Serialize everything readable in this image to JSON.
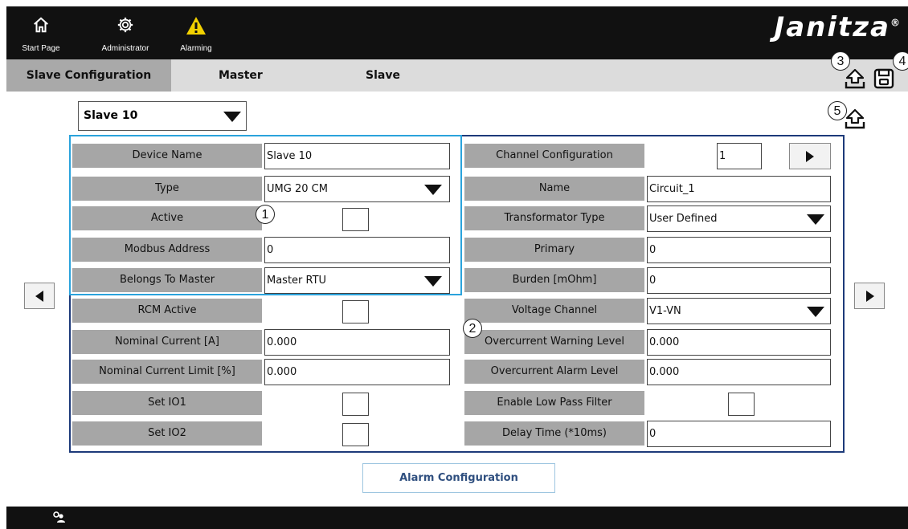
{
  "nav": {
    "start_page": "Start Page",
    "administrator": "Administrator",
    "alarming": "Alarming",
    "logo": "Janitza",
    "logo_mark": "®"
  },
  "tabs": {
    "slave_configuration": "Slave Configuration",
    "master": "Master",
    "slave": "Slave"
  },
  "device_select": {
    "value": "Slave 10"
  },
  "left_panel": {
    "device_name": {
      "label": "Device Name",
      "value": "Slave 10"
    },
    "type": {
      "label": "Type",
      "value": "UMG 20 CM"
    },
    "active": {
      "label": "Active"
    },
    "modbus_address": {
      "label": "Modbus Address",
      "value": "0"
    },
    "belongs_to_master": {
      "label": "Belongs To Master",
      "value": "Master RTU"
    },
    "rcm_active": {
      "label": "RCM Active"
    },
    "nominal_current": {
      "label": "Nominal Current [A]",
      "value": "0.000"
    },
    "nominal_current_limit": {
      "label": "Nominal Current Limit [%]",
      "value": "0.000"
    },
    "set_io1": {
      "label": "Set IO1"
    },
    "set_io2": {
      "label": "Set IO2"
    }
  },
  "right_panel": {
    "channel_configuration": {
      "label": "Channel Configuration",
      "value": "1"
    },
    "name": {
      "label": "Name",
      "value": "Circuit_1"
    },
    "transformator_type": {
      "label": "Transformator Type",
      "value": "User Defined"
    },
    "primary": {
      "label": "Primary",
      "value": "0"
    },
    "burden": {
      "label": "Burden [mOhm]",
      "value": "0"
    },
    "voltage_channel": {
      "label": "Voltage Channel",
      "value": "V1-VN"
    },
    "overcurrent_warning": {
      "label": "Overcurrent Warning Level",
      "value": "0.000"
    },
    "overcurrent_alarm": {
      "label": "Overcurrent Alarm Level",
      "value": "0.000"
    },
    "low_pass_filter": {
      "label": "Enable Low Pass Filter"
    },
    "delay_time": {
      "label": "Delay Time (*10ms)",
      "value": "0"
    }
  },
  "callouts": [
    "1",
    "2",
    "3",
    "4",
    "5"
  ],
  "alarm_button": "Alarm Configuration",
  "colors": {
    "top_bar": "#111111",
    "tab_bar": "#dcdcdc",
    "tab_active": "#a9a9a9",
    "label_cell": "#a6a6a6",
    "frame_light": "#2aa3dc",
    "frame_dark": "#1d3a7a",
    "alarm_icon": "#f2d100"
  },
  "icons": [
    "home-icon",
    "gear-icon",
    "warning-icon",
    "upload-icon",
    "save-icon",
    "arrow-left-icon",
    "arrow-right-icon",
    "user-icon"
  ]
}
